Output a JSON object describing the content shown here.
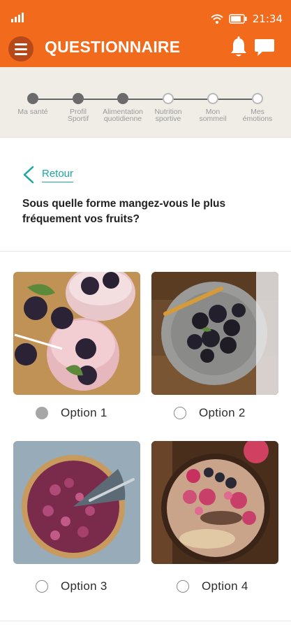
{
  "status_bar": {
    "time": "21:34"
  },
  "header": {
    "title": "QUESTIONNAIRE"
  },
  "progress": {
    "steps": [
      {
        "label_l1": "Ma santé",
        "label_l2": "",
        "state": "done"
      },
      {
        "label_l1": "Profil",
        "label_l2": "Sportif",
        "state": "done"
      },
      {
        "label_l1": "Alimentation",
        "label_l2": "quotidienne",
        "state": "done"
      },
      {
        "label_l1": "Nutrition",
        "label_l2": "sportive",
        "state": "todo"
      },
      {
        "label_l1": "Mon",
        "label_l2": "sommeil",
        "state": "todo"
      },
      {
        "label_l1": "Mes",
        "label_l2": "émotions",
        "state": "todo"
      }
    ]
  },
  "question_section": {
    "back_label": "Retour",
    "question": "Sous quelle forme mangez-vous le plus fréquement vos fruits?"
  },
  "options": [
    {
      "label": "Option 1",
      "selected": true
    },
    {
      "label": "Option 2",
      "selected": false
    },
    {
      "label": "Option 3",
      "selected": false
    },
    {
      "label": "Option 4",
      "selected": false
    }
  ],
  "colors": {
    "header_bg": "#f26a1b",
    "menu_btn_bg": "#b6481a",
    "progress_bg": "#f0ede6",
    "accent_teal": "#1aa7a0",
    "selected_radio": "#a6a6a6"
  },
  "icons": [
    "signal-icon",
    "wifi-icon",
    "battery-icon",
    "menu-icon",
    "bell-icon",
    "chat-icon",
    "back-chevron-icon"
  ]
}
